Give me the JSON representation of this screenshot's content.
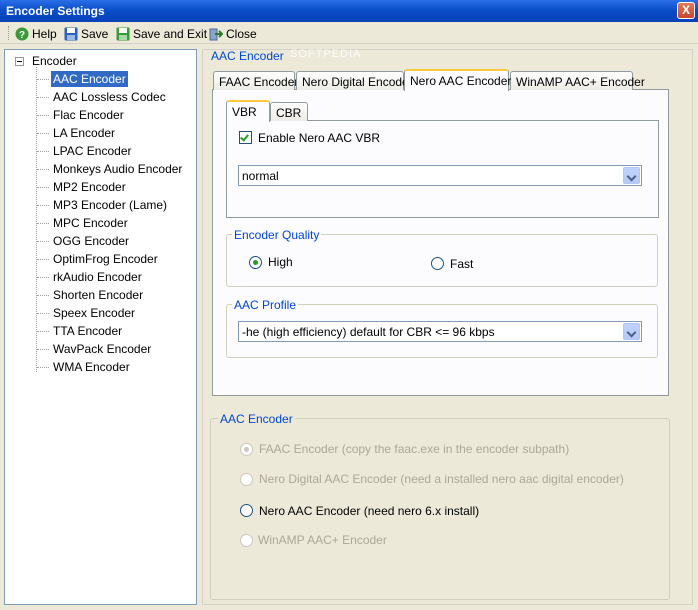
{
  "window": {
    "title": "Encoder Settings",
    "close_glyph": "X"
  },
  "toolbar": {
    "help_label": "Help",
    "save_label": "Save",
    "save_exit_label": "Save and Exit",
    "close_label": "Close"
  },
  "tree": {
    "root_label": "Encoder",
    "items": [
      "AAC Encoder",
      "AAC Lossless Codec",
      "Flac Encoder",
      "LA Encoder",
      "LPAC Encoder",
      "Monkeys Audio Encoder",
      "MP2 Encoder",
      "MP3 Encoder (Lame)",
      "MPC Encoder",
      "OGG Encoder",
      "OptimFrog Encoder",
      "rkAudio Encoder",
      "Shorten Encoder",
      "Speex Encoder",
      "TTA Encoder",
      "WavPack Encoder",
      "WMA Encoder"
    ],
    "selected": "AAC Encoder"
  },
  "panel": {
    "title": "AAC Encoder",
    "tabs": [
      "FAAC Encoder",
      "Nero Digital Encoder",
      "Nero AAC Encoder",
      "WinAMP AAC+ Encoder"
    ],
    "active_tab": "Nero AAC Encoder",
    "inner_tabs": [
      "VBR",
      "CBR"
    ],
    "active_inner_tab": "VBR",
    "vbr_checkbox_label": "Enable Nero AAC VBR",
    "vbr_checked": true,
    "vbr_mode_value": "normal",
    "quality_group": "Encoder Quality",
    "quality_high": "High",
    "quality_fast": "Fast",
    "quality_selected": "High",
    "profile_group": "AAC Profile",
    "profile_value": "-he (high efficiency) default for CBR <= 96 kbps"
  },
  "encoder_group": {
    "title": "AAC Encoder",
    "options": [
      {
        "label": "FAAC Encoder (copy the faac.exe in the encoder subpath)",
        "enabled": false,
        "selected": true
      },
      {
        "label": "Nero Digital AAC Encoder (need a installed nero aac digital encoder)",
        "enabled": false,
        "selected": false
      },
      {
        "label": "Nero AAC Encoder (need nero 6.x install)",
        "enabled": true,
        "selected": false
      },
      {
        "label": "WinAMP AAC+ Encoder",
        "enabled": false,
        "selected": false
      }
    ]
  },
  "watermark": "SOFTPEDIA",
  "colors": {
    "title_bar": "#0a4ec8",
    "selection": "#316ac5",
    "group_title": "#0046d5",
    "check_green": "#21a121"
  }
}
